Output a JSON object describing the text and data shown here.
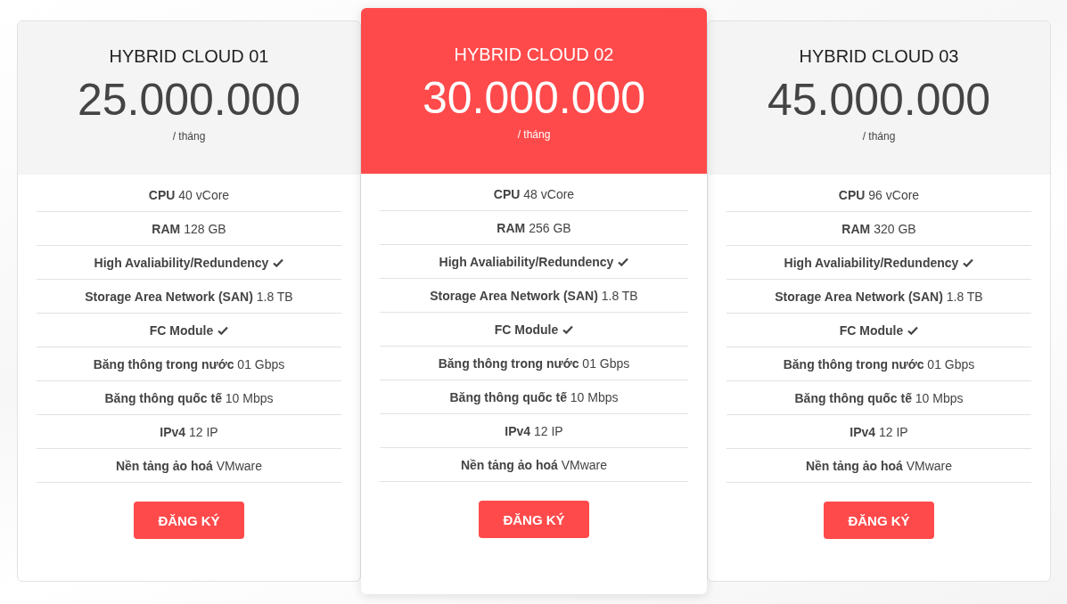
{
  "plans": [
    {
      "title": "HYBRID CLOUD 01",
      "price": "25.000.000",
      "period": "/ tháng",
      "featured": false,
      "features": [
        {
          "name": "CPU",
          "value": "40 vCore",
          "check": false
        },
        {
          "name": "RAM",
          "value": "128 GB",
          "check": false
        },
        {
          "name": "High Avaliability/Redundency",
          "check": true
        },
        {
          "name": "Storage Area Network (SAN)",
          "value": "1.8 TB",
          "check": false
        },
        {
          "name": "FC Module",
          "check": true
        },
        {
          "name": "Băng thông trong nước",
          "value": "01 Gbps",
          "check": false
        },
        {
          "name": "Băng thông quốc tế",
          "value": "10 Mbps",
          "check": false
        },
        {
          "name": "IPv4",
          "value": "12 IP",
          "check": false
        },
        {
          "name": "Nền tảng ảo hoá",
          "value": "VMware",
          "check": false
        }
      ],
      "button": "ĐĂNG KÝ"
    },
    {
      "title": "HYBRID CLOUD 02",
      "price": "30.000.000",
      "period": "/ tháng",
      "featured": true,
      "features": [
        {
          "name": "CPU",
          "value": "48 vCore",
          "check": false
        },
        {
          "name": "RAM",
          "value": "256 GB",
          "check": false
        },
        {
          "name": "High Avaliability/Redundency",
          "check": true
        },
        {
          "name": "Storage Area Network (SAN)",
          "value": "1.8 TB",
          "check": false
        },
        {
          "name": "FC Module",
          "check": true
        },
        {
          "name": "Băng thông trong nước",
          "value": "01 Gbps",
          "check": false
        },
        {
          "name": "Băng thông quốc tế",
          "value": "10 Mbps",
          "check": false
        },
        {
          "name": "IPv4",
          "value": "12 IP",
          "check": false
        },
        {
          "name": "Nền tảng ảo hoá",
          "value": "VMware",
          "check": false
        }
      ],
      "button": "ĐĂNG KÝ"
    },
    {
      "title": "HYBRID CLOUD 03",
      "price": "45.000.000",
      "period": "/ tháng",
      "featured": false,
      "features": [
        {
          "name": "CPU",
          "value": "96 vCore",
          "check": false
        },
        {
          "name": "RAM",
          "value": "320 GB",
          "check": false
        },
        {
          "name": "High Avaliability/Redundency",
          "check": true
        },
        {
          "name": "Storage Area Network (SAN)",
          "value": "1.8 TB",
          "check": false
        },
        {
          "name": "FC Module",
          "check": true
        },
        {
          "name": "Băng thông trong nước",
          "value": "01 Gbps",
          "check": false
        },
        {
          "name": "Băng thông quốc tế",
          "value": "10 Mbps",
          "check": false
        },
        {
          "name": "IPv4",
          "value": "12 IP",
          "check": false
        },
        {
          "name": "Nền tảng ảo hoá",
          "value": "VMware",
          "check": false
        }
      ],
      "button": "ĐĂNG KÝ"
    }
  ]
}
